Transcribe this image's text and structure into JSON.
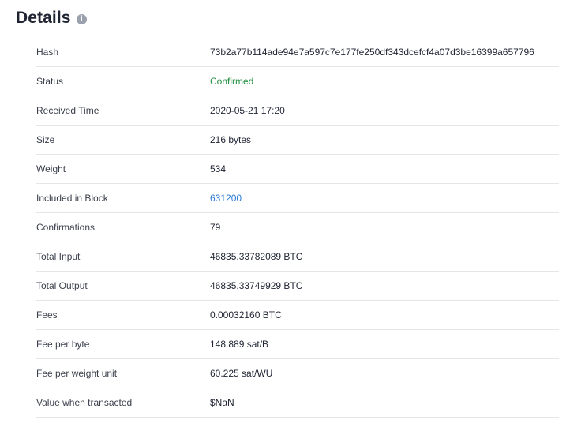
{
  "header": {
    "title": "Details",
    "info_icon": "info-icon"
  },
  "colors": {
    "confirmed": "#1e8e3e",
    "link": "#2a7bd6",
    "divider": "#e4e6ea"
  },
  "details": [
    {
      "label": "Hash",
      "value": "73b2a77b114ade94e7a597c7e177fe250df343dcefcf4a07d3be16399a657796"
    },
    {
      "label": "Status",
      "value": "Confirmed"
    },
    {
      "label": "Received Time",
      "value": "2020-05-21 17:20"
    },
    {
      "label": "Size",
      "value": "216 bytes"
    },
    {
      "label": "Weight",
      "value": "534"
    },
    {
      "label": "Included in Block",
      "value": "631200"
    },
    {
      "label": "Confirmations",
      "value": "79"
    },
    {
      "label": "Total Input",
      "value": "46835.33782089 BTC"
    },
    {
      "label": "Total Output",
      "value": "46835.33749929 BTC"
    },
    {
      "label": "Fees",
      "value": "0.00032160 BTC"
    },
    {
      "label": "Fee per byte",
      "value": "148.889 sat/B"
    },
    {
      "label": "Fee per weight unit",
      "value": "60.225 sat/WU"
    },
    {
      "label": "Value when transacted",
      "value": "$NaN"
    }
  ]
}
